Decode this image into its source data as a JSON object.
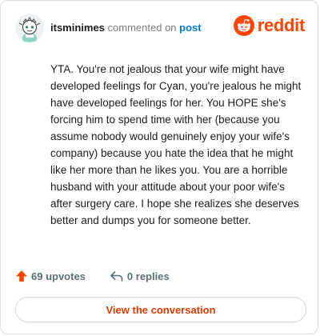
{
  "header": {
    "username": "itsminimes",
    "commented_text": "commented on",
    "post_link": "post",
    "brand_name": "reddit"
  },
  "comment": {
    "body": "YTA. You're not jealous that your wife might have developed feelings for Cyan, you're jealous he might have developed feelings for her. You HOPE she's forcing him to spend time with her (because you assume nobody would genuinely enjoy your wife's company) because you hate the idea that he might like her more than he likes you. You are a horrible husband with your attitude about your poor wife's after surgery care. I hope she realizes she deserves better and dumps you for someone better."
  },
  "footer": {
    "upvotes_label": "69 upvotes",
    "replies_label": "0 replies"
  },
  "actions": {
    "view_conversation_label": "View the conversation"
  },
  "colors": {
    "brand": "#ff4500",
    "link": "#0079d3",
    "action_text": "#d93900",
    "muted": "#576f76"
  },
  "icons": {
    "avatar": "snoo-avatar-icon",
    "brand": "reddit-logo-icon",
    "upvote": "upvote-arrow-icon",
    "reply": "reply-arrow-icon"
  }
}
